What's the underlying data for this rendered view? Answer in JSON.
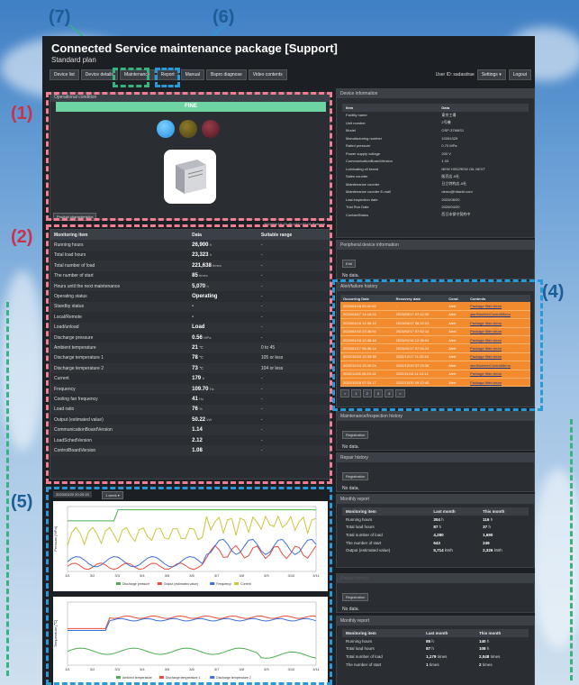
{
  "callouts": {
    "c1": "(1)",
    "c2": "(2)",
    "c4": "(4)",
    "c5": "(5)",
    "c6": "(6)",
    "c7": "(7)"
  },
  "app": {
    "title": "Connected Service maintenance package [Support]",
    "subtitle": "Standard plan"
  },
  "tabs": [
    "Device list",
    "Device details",
    "Maintenance",
    "Report",
    "Manual",
    "Bspro diagnose",
    "Video contents"
  ],
  "top_right": {
    "user": "User ID: sadasdrae",
    "settings": "Settings ▾",
    "logout": "Logout"
  },
  "operational": {
    "header": "Operational condition",
    "status": "FINE",
    "button": "Product characteristics",
    "timestamp": "2024/04/18 23:45 UTC+02:00  Refresh"
  },
  "monitoring": {
    "columns": [
      "Monitoring item",
      "Data",
      "Suitable range"
    ],
    "rows": [
      {
        "item": "Running hours",
        "data": "26,900",
        "unit": "h",
        "range": "-"
      },
      {
        "item": "Total load hours",
        "data": "23,323",
        "unit": "h",
        "range": "-"
      },
      {
        "item": "Total number of load",
        "data": "221,638",
        "unit": "times",
        "range": "-"
      },
      {
        "item": "The number of start",
        "data": "85",
        "unit": "times",
        "range": "-"
      },
      {
        "item": "Hours until the next maintenance",
        "data": "5,070",
        "unit": "h",
        "range": "-"
      },
      {
        "item": "Operating status",
        "data": "Operating",
        "unit": "",
        "range": "-"
      },
      {
        "item": "Standby status",
        "data": "-",
        "unit": "",
        "range": "-"
      },
      {
        "item": "Local/Remote",
        "data": "-",
        "unit": "",
        "range": "-"
      },
      {
        "item": "Load/unload",
        "data": "Load",
        "unit": "",
        "range": "-"
      },
      {
        "item": "Discharge pressure",
        "data": "0.56",
        "unit": "MPa",
        "range": "-"
      },
      {
        "item": "Ambient temperature",
        "data": "21",
        "unit": "℃",
        "range": "0 to 45"
      },
      {
        "item": "Discharge temperature 1",
        "data": "78",
        "unit": "℃",
        "range": "105 or less"
      },
      {
        "item": "Discharge temperature 2",
        "data": "73",
        "unit": "℃",
        "range": "104 or less"
      },
      {
        "item": "Current",
        "data": "179",
        "unit": "A",
        "range": "-"
      },
      {
        "item": "Frequency",
        "data": "109.70",
        "unit": "Hz",
        "range": "-"
      },
      {
        "item": "Cooling fan frequency",
        "data": "41",
        "unit": "Hz",
        "range": "-"
      },
      {
        "item": "Load ratio",
        "data": "76",
        "unit": "%",
        "range": "-"
      },
      {
        "item": "Output (estimated value)",
        "data": "50.22",
        "unit": "kW",
        "range": "-"
      },
      {
        "item": "CommunicationBoardVersion",
        "data": "1.14",
        "unit": "",
        "range": "-"
      },
      {
        "item": "LoadSchedVersion",
        "data": "2.12",
        "unit": "",
        "range": "-"
      },
      {
        "item": "ControlBoardVersion",
        "data": "1.08",
        "unit": "",
        "range": "-"
      }
    ]
  },
  "trend": {
    "date": "2023/03/20 20:20:15",
    "range": "1 week ▾",
    "ylabel_top": "Pressure [MPa]",
    "ylabel_top_right": "Amperage(A)/Frequency(Hz)",
    "ylabel_bottom": "Temperature [℃]",
    "xticks": [
      "3/1",
      "3/2",
      "3/3",
      "3/4",
      "3/5",
      "3/6",
      "3/7",
      "3/8",
      "3/9",
      "3/10",
      "3/11"
    ],
    "legend_top": [
      "Discharge pressure",
      "Output (estimated value)",
      "Frequency",
      "Current"
    ],
    "legend_bottom": [
      "Ambient temperature",
      "Discharge temperature 1",
      "Discharge temperature 2"
    ],
    "colors_top": [
      "#4caf50",
      "#e74c3c",
      "#3f6fd8",
      "#c9c63a"
    ],
    "colors_bottom": [
      "#4caf50",
      "#e74c3c",
      "#3f6fd8"
    ]
  },
  "device_info": {
    "header": "Device information",
    "columns": [
      "Item",
      "Data"
    ],
    "rows": [
      [
        "Facility name",
        "東京工場"
      ],
      [
        "Unit number",
        "2号機"
      ],
      [
        "Model",
        "OSP-37M6S1"
      ],
      [
        "Manufacturing number",
        "10261329"
      ],
      [
        "Rated pressure",
        "0.70 MPa"
      ],
      [
        "Power supply voltage",
        "200 V"
      ],
      [
        "CommunicationBoardVersion",
        "1.03"
      ],
      [
        "Lubricating oil brand",
        "NEW HISCREW OIL NEXT"
      ],
      [
        "Sales counter",
        "販売店 A社"
      ],
      [
        "Maintenance counter",
        "日立特約店 A社"
      ],
      [
        "Maintenance counter E-mail",
        "demo@hitachi.com"
      ],
      [
        "Last inspection date",
        "2022/08/20"
      ],
      [
        "Trial Run Date",
        "2020/04/20"
      ],
      [
        "ContactStatus",
        "西日本保守契約中"
      ]
    ]
  },
  "peripheral": {
    "header": "Peripheral device information",
    "button": "Edit",
    "nodata": "No data."
  },
  "alarm": {
    "header": "Alert/failure history",
    "columns": [
      "Occurring Date",
      "Recovery date",
      "Cond.",
      "Contents"
    ],
    "rows": [
      [
        "2023/04/18 09:41:52",
        "-",
        "Alert",
        "Package filter clean"
      ],
      [
        "2023/03/17 14:16:22",
        "2023/03/17 07:12:30",
        "Alert",
        "alertNumberControlMenu"
      ],
      [
        "2023/03/16 14:36:12",
        "2023/03/17 08:12:23",
        "Alert",
        "Package filter clean"
      ],
      [
        "2023/02/16 23:36:54",
        "2023/02/17 07:52:14",
        "Alert",
        "Package filter clean"
      ],
      [
        "2023/01/18 12:38:48",
        "2023/01/18 12:38:54",
        "Alert",
        "Package filter clean"
      ],
      [
        "2023/01/17 06:36:14",
        "2023/01/17 07:24:24",
        "Alert",
        "Package filter clean"
      ],
      [
        "2022/12/24 15:33:36",
        "2022/12/17 11:25:24",
        "Alert",
        "Package filter clean"
      ],
      [
        "2022/12/24 15:30:24",
        "2022/12/19 07:19:36",
        "Alert",
        "alertNumberControlMenu"
      ],
      [
        "2022/11/06 05:20:13",
        "2022/11/16 11:12:12",
        "Alert",
        "Package filter clean"
      ],
      [
        "2022/10/18 07:24:17",
        "2022/10/20 09:12:45",
        "Alert",
        "Package filter clean"
      ]
    ],
    "pager": [
      "<",
      "1",
      "2",
      "3",
      "4",
      ">"
    ]
  },
  "maintenance": {
    "header": "Maintenance/Inspection history",
    "button": "Registration",
    "nodata": "No data."
  },
  "repair": {
    "header": "Repair history",
    "button": "Registration",
    "nodata": "No data."
  },
  "monthly1": {
    "header": "Monthly report",
    "columns": [
      "Monitoring item",
      "Last month",
      "This month"
    ],
    "rows": [
      [
        "Running hours",
        "304",
        "h",
        "116",
        "h"
      ],
      [
        "Total load hours",
        "87",
        "h",
        "37",
        "h"
      ],
      [
        "Total number of load",
        "4,280",
        "",
        "1,690",
        ""
      ],
      [
        "The number of start",
        "643",
        "",
        "249",
        ""
      ],
      [
        "Output (estimated value)",
        "5,714",
        "kWh",
        "2,326",
        "kWh"
      ]
    ]
  },
  "hidden_panel": {
    "header": "Repair history",
    "button": "Registration",
    "nodata": "No data."
  },
  "monthly2": {
    "header": "Monthly report",
    "columns": [
      "Monitoring item",
      "Last month",
      "This month"
    ],
    "rows": [
      [
        "Running hours",
        "85",
        "h",
        "140",
        "h"
      ],
      [
        "Total load hours",
        "87",
        "h",
        "108",
        "h"
      ],
      [
        "Total number of load",
        "1,179",
        "times",
        "2,048",
        "times"
      ],
      [
        "The number of start",
        "1",
        "times",
        "2",
        "times"
      ]
    ]
  }
}
